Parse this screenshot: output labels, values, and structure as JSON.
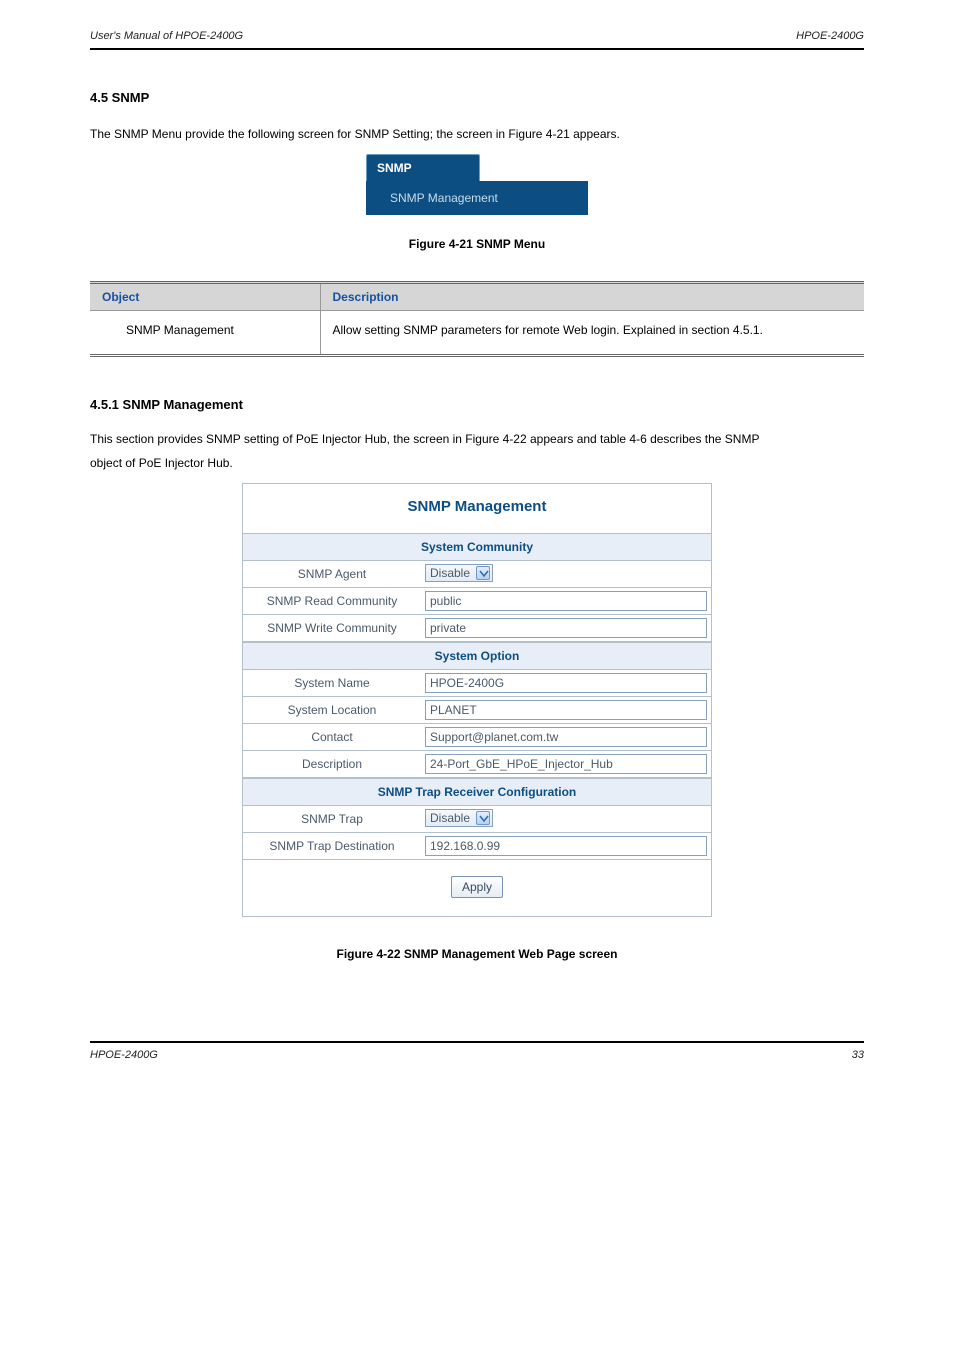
{
  "header": {
    "left": "User's Manual of HPOE-2400G",
    "right": "HPOE-2400G"
  },
  "section": {
    "num": "4.5 SNMP",
    "intro": "The SNMP Menu provide the following screen for SNMP Setting; the screen in Figure 4-21 appears."
  },
  "nav": {
    "tab": "SNMP",
    "sub": "SNMP Management"
  },
  "figcap1": "Figure 4-21 SNMP Menu",
  "info_table": {
    "col1_hdr": "Object",
    "col2_hdr": "Description",
    "row_bullet": "",
    "row_label": "SNMP Management",
    "row_desc": "Allow setting SNMP parameters for remote Web login. Explained in section 4.5.1."
  },
  "subsection": {
    "num": "4.5.1 SNMP Management",
    "intro1": "This section provides SNMP setting of PoE Injector Hub, the screen in Figure 4-22 appears and table 4-6 describes the SNMP",
    "intro2": "object of PoE Injector Hub."
  },
  "snmp": {
    "title": "SNMP Management",
    "sec_community": "System Community",
    "agent_label": "SNMP Agent",
    "agent_value": "Disable",
    "readcomm_label": "SNMP Read Community",
    "readcomm_value": "public",
    "writecomm_label": "SNMP Write Community",
    "writecomm_value": "private",
    "sec_option": "System Option",
    "sysname_label": "System Name",
    "sysname_value": "HPOE-2400G",
    "sysloc_label": "System Location",
    "sysloc_value": "PLANET",
    "contact_label": "Contact",
    "contact_value": "Support@planet.com.tw",
    "desc_label": "Description",
    "desc_value": "24-Port_GbE_HPoE_Injector_Hub",
    "sec_trap": "SNMP Trap Receiver Configuration",
    "trap_label": "SNMP Trap",
    "trap_value": "Disable",
    "trapdest_label": "SNMP Trap Destination",
    "trapdest_value": "192.168.0.99",
    "apply": "Apply"
  },
  "figcap2": "Figure 4-22 SNMP Management Web Page screen",
  "footer": {
    "left": "HPOE-2400G",
    "right": "33"
  }
}
